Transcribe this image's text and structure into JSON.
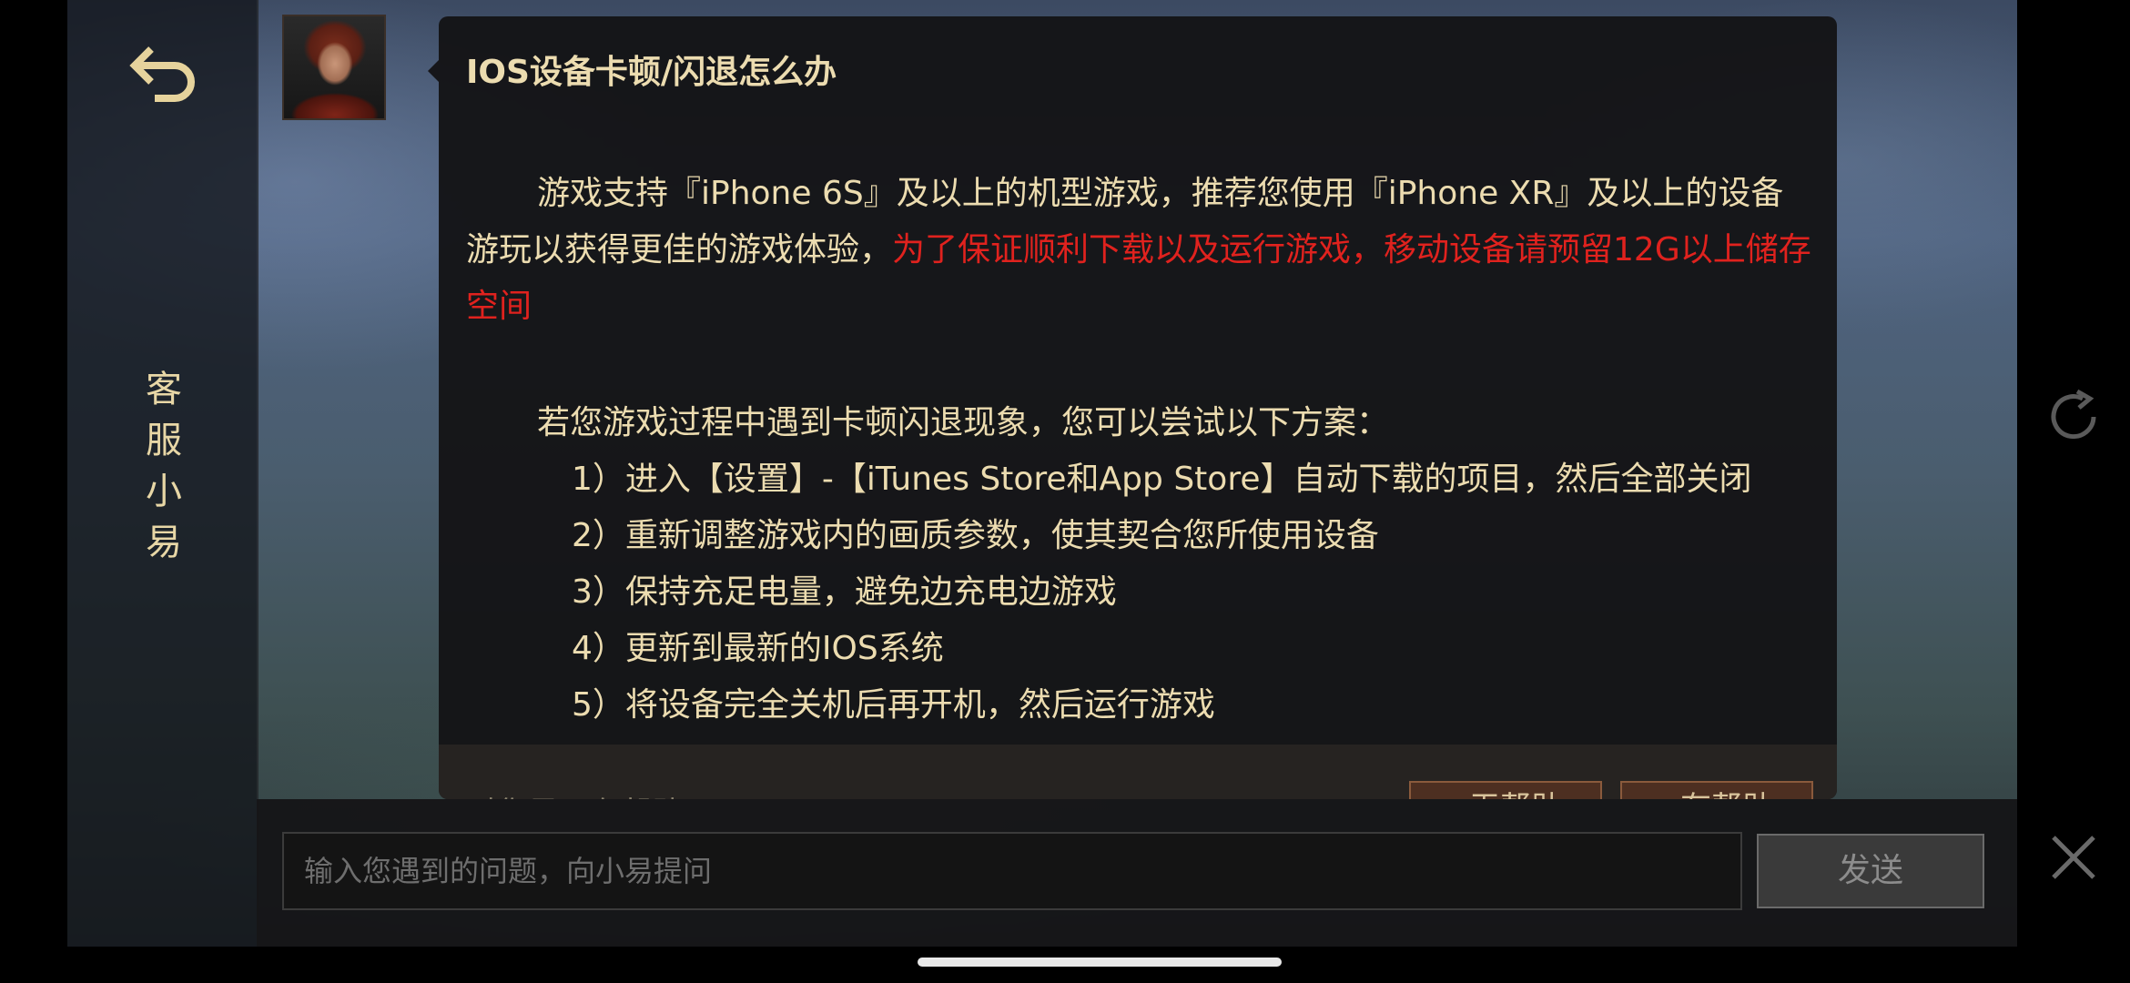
{
  "sidebar": {
    "title_chars": [
      "客",
      "服",
      "小",
      "易"
    ]
  },
  "article": {
    "title": "IOS设备卡顿/闪退怎么办",
    "intro_normal": "游戏支持『iPhone 6S』及以上的机型游戏，推荐您使用『iPhone XR』及以上的设备游玩以获得更佳的游戏体验，",
    "intro_red": "为了保证顺利下载以及运行游戏，移动设备请预留12G以上储存空间",
    "tips_intro": "若您游戏过程中遇到卡顿闪退现象，您可以尝试以下方案：",
    "tips": [
      "1）进入【设置】-【iTunes Store和App Store】自动下载的项目，然后全部关闭",
      "2）重新调整游戏内的画质参数，使其契合您所使用设备",
      "3）保持充足电量，避免边充电边游戏",
      "4）更新到最新的IOS系统",
      "5）将设备完全关机后再开机，然后运行游戏"
    ],
    "highlight_color": "#e0221e"
  },
  "feedback": {
    "question": "对您是否有帮助?",
    "not_helpful_label": "无帮助",
    "helpful_label": "有帮助"
  },
  "composer": {
    "placeholder": "输入您遇到的问题，向小易提问",
    "value": "",
    "send_label": "发送"
  },
  "icons": {
    "back": "back-arrow-icon",
    "refresh": "refresh-icon",
    "close": "close-icon",
    "thumbs_down": "thumbs-down-icon",
    "thumbs_up": "thumbs-up-icon"
  }
}
